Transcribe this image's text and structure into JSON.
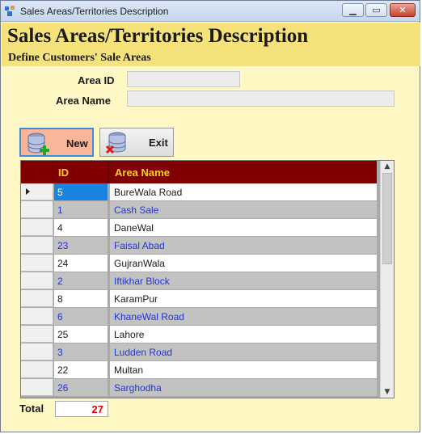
{
  "window": {
    "title": "Sales Areas/Territories Description",
    "minimize_glyph": "▁",
    "maximize_glyph": "▭",
    "close_glyph": "✕"
  },
  "header": {
    "title": "Sales Areas/Territories Description",
    "subtitle": "Define Customers' Sale Areas",
    "background_color": "#f5e27a"
  },
  "form": {
    "area_id_label": "Area ID",
    "area_id_value": "",
    "area_name_label": "Area Name",
    "area_name_value": ""
  },
  "toolbar": {
    "new_label": "New",
    "new_icon": "database-add-icon",
    "exit_label": "Exit",
    "exit_icon": "database-delete-icon"
  },
  "grid": {
    "columns": [
      "ID",
      "Area Name"
    ],
    "header_color": "#800000",
    "header_text_color": "#ffd21a",
    "rows": [
      {
        "id": "5",
        "name": "BureWala Road"
      },
      {
        "id": "1",
        "name": "Cash Sale"
      },
      {
        "id": "4",
        "name": "DaneWal"
      },
      {
        "id": "23",
        "name": "Faisal Abad"
      },
      {
        "id": "24",
        "name": "GujranWala"
      },
      {
        "id": "2",
        "name": "Iftikhar Block"
      },
      {
        "id": "8",
        "name": "KaramPur"
      },
      {
        "id": "6",
        "name": "KhaneWal Road"
      },
      {
        "id": "25",
        "name": "Lahore"
      },
      {
        "id": "3",
        "name": "Ludden Road"
      },
      {
        "id": "22",
        "name": "Multan"
      },
      {
        "id": "26",
        "name": "Sarghodha"
      }
    ],
    "selected_row": 0
  },
  "footer": {
    "total_label": "Total",
    "total_value": "27"
  }
}
